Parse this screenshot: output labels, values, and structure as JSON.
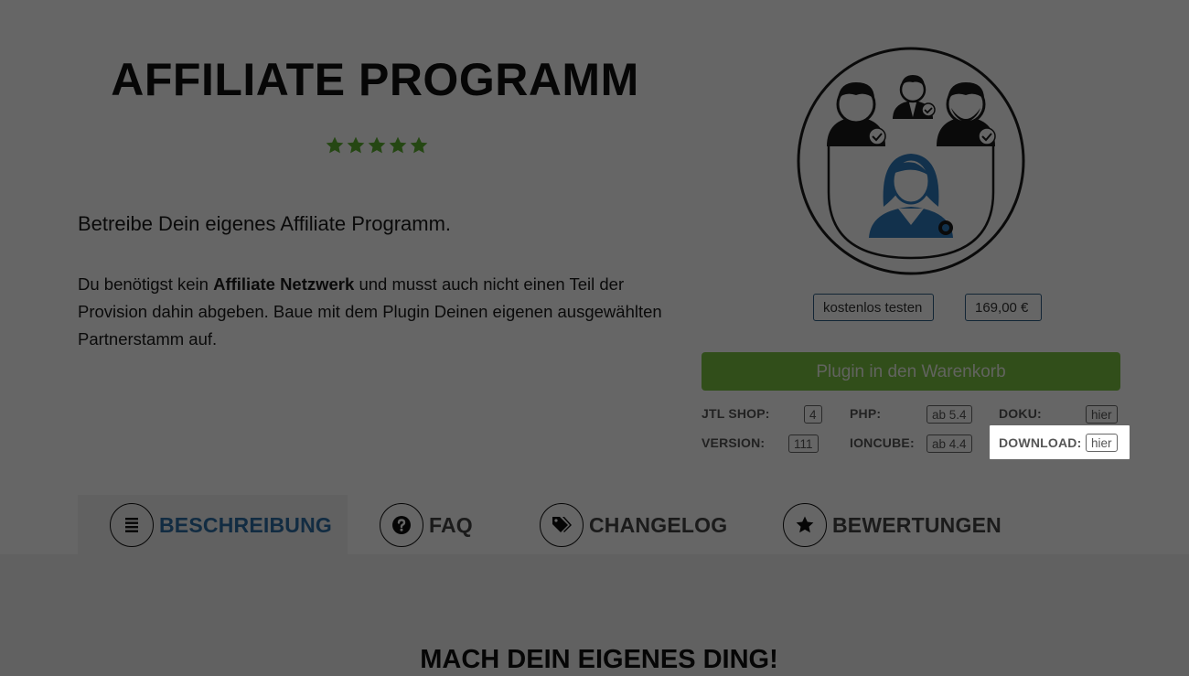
{
  "product": {
    "title": "AFFILIATE PROGRAMM",
    "rating_stars": 5,
    "lead": "Betreibe Dein eigenes Affiliate Programm.",
    "desc_part1": "Du benötigst kein ",
    "desc_bold": "Affiliate Netzwerk",
    "desc_part2": " und musst auch nicht einen Teil der Provision dahin abgeben. Baue mit dem Plugin Deinen eigenen ausgewählten Partnerstamm auf."
  },
  "pricing": {
    "try_label": "kostenlos testen",
    "price": "169,00 €",
    "cart_button": "Plugin in den Warenkorb"
  },
  "specs": {
    "jtl_shop_label": "JTL SHOP:",
    "jtl_shop_value": "4",
    "php_label": "PHP:",
    "php_value": "ab 5.4",
    "doku_label": "DOKU:",
    "doku_value": "hier",
    "version_label": "VERSION:",
    "version_value": "111",
    "ioncube_label": "IONCUBE:",
    "ioncube_value": "ab 4.4",
    "download_label": "DOWNLOAD:",
    "download_value": "hier"
  },
  "tabs": [
    {
      "label": "BESCHREIBUNG",
      "icon": "list-icon",
      "active": true
    },
    {
      "label": "FAQ",
      "icon": "question-icon"
    },
    {
      "label": "CHANGELOG",
      "icon": "tags-icon"
    },
    {
      "label": "BEWERTUNGEN",
      "icon": "star-icon"
    }
  ],
  "section": {
    "title": "MACH DEIN EIGENES DING!"
  },
  "colors": {
    "accent_blue": "#2d6ea6",
    "cart_green": "#7cc243",
    "star_green": "#5cb131",
    "overlay": "rgba(0,0,0,0.6)"
  }
}
